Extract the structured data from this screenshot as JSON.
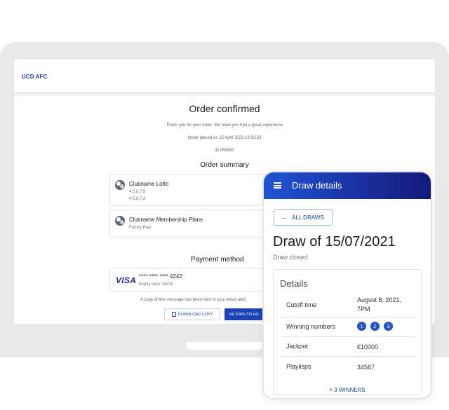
{
  "desktop": {
    "brand": "UCD AFC",
    "order": {
      "title": "Order confirmed",
      "thanks": "Thank you for your order. We hope you had a great experience",
      "placed": "Order placed on 15 April 2022 13:53:53",
      "id": "ID 058980"
    },
    "summary": {
      "title": "Order summary",
      "items": [
        {
          "name": "Clubname Lotto",
          "lines": [
            "4,5,6,7,8",
            "4,5,6,7,8"
          ]
        },
        {
          "name": "Clubname Membership Plans",
          "lines": [
            "Family Plan"
          ]
        }
      ]
    },
    "payment": {
      "title": "Payment method",
      "brand": "VISA",
      "number": "**** **** **** 4242",
      "expiry": "Expiry date: 04/24"
    },
    "email_note": "A copy of this message has been sent to your email addr",
    "buttons": {
      "download": "DOWNLOAD COPY",
      "return": "RETURN TO HO"
    }
  },
  "phone": {
    "app_title": "Draw details",
    "back_button": "ALL DRAWS",
    "draw_title": "Draw of 15/07/2021",
    "status": "Draw closed",
    "details": {
      "title": "Details",
      "rows": [
        {
          "label": "Cutoff time",
          "value": "August 8, 2021, 7PM"
        },
        {
          "label": "Winning numbers",
          "balls": [
            "1",
            "2",
            "3"
          ]
        },
        {
          "label": "Jackpot",
          "value": "€10000"
        },
        {
          "label": "Playlisps",
          "value": "34567"
        }
      ]
    },
    "winners_link": "3 WINNERS"
  },
  "colors": {
    "primary": "#1a43b8",
    "header_gradient_end": "#131a7c",
    "ball": "#1f55c8"
  }
}
